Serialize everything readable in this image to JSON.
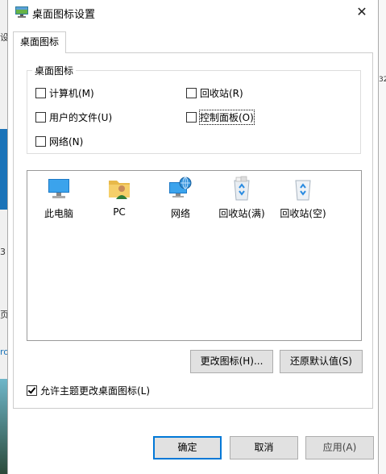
{
  "dialog": {
    "title": "桌面图标设置",
    "close_glyph": "✕"
  },
  "tabs": [
    {
      "label": "桌面图标"
    }
  ],
  "group": {
    "legend": "桌面图标",
    "checkboxes": [
      {
        "label": "计算机(M)",
        "checked": false
      },
      {
        "label": "回收站(R)",
        "checked": false
      },
      {
        "label": "用户的文件(U)",
        "checked": false
      },
      {
        "label": "控制面板(O)",
        "checked": false
      },
      {
        "label": "网络(N)",
        "checked": false
      }
    ]
  },
  "icons": [
    {
      "label": "此电脑",
      "icon": "computer-icon"
    },
    {
      "label": "PC",
      "icon": "user-folder-icon"
    },
    {
      "label": "网络",
      "icon": "network-icon"
    },
    {
      "label": "回收站(满)",
      "icon": "recycle-bin-full-icon"
    },
    {
      "label": "回收站(空)",
      "icon": "recycle-bin-empty-icon"
    }
  ],
  "buttons": {
    "change_icon": "更改图标(H)...",
    "restore_default": "还原默认值(S)",
    "ok": "确定",
    "cancel": "取消",
    "apply": "应用(A)"
  },
  "allow_themes": {
    "label": "允许主题更改桌面图标(L)",
    "checked": true
  },
  "background": {
    "left_texts": [
      "设",
      "3",
      "页",
      "ro"
    ],
    "right_text": "32"
  }
}
